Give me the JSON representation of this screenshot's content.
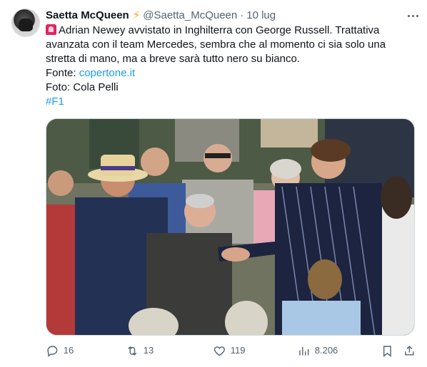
{
  "author": {
    "name": "Saetta McQueen",
    "badge_icon": "lightning-bolt-icon",
    "handle": "@Saetta_McQueen",
    "separator": "·",
    "date": "10 lug"
  },
  "tweet": {
    "lead_icon": "rotating-light-icon",
    "line1": "Adrian Newey avvistato in Inghilterra con George Russell. Trattativa avanzata con il team Mercedes, sembra che al momento ci sia solo una stretta di mano, ma a breve sarà tutto nero su bianco.",
    "source_label": "Fonte: ",
    "source_link": "copertone.it",
    "photo_credit": "Foto: Cola Pelli",
    "hashtag": "#F1"
  },
  "actions": {
    "replies": "16",
    "retweets": "13",
    "likes": "119",
    "views": "8.206"
  },
  "colors": {
    "accent": "#1d9bf0",
    "text": "#0f1419",
    "muted": "#536471",
    "border": "#cfd9de"
  }
}
